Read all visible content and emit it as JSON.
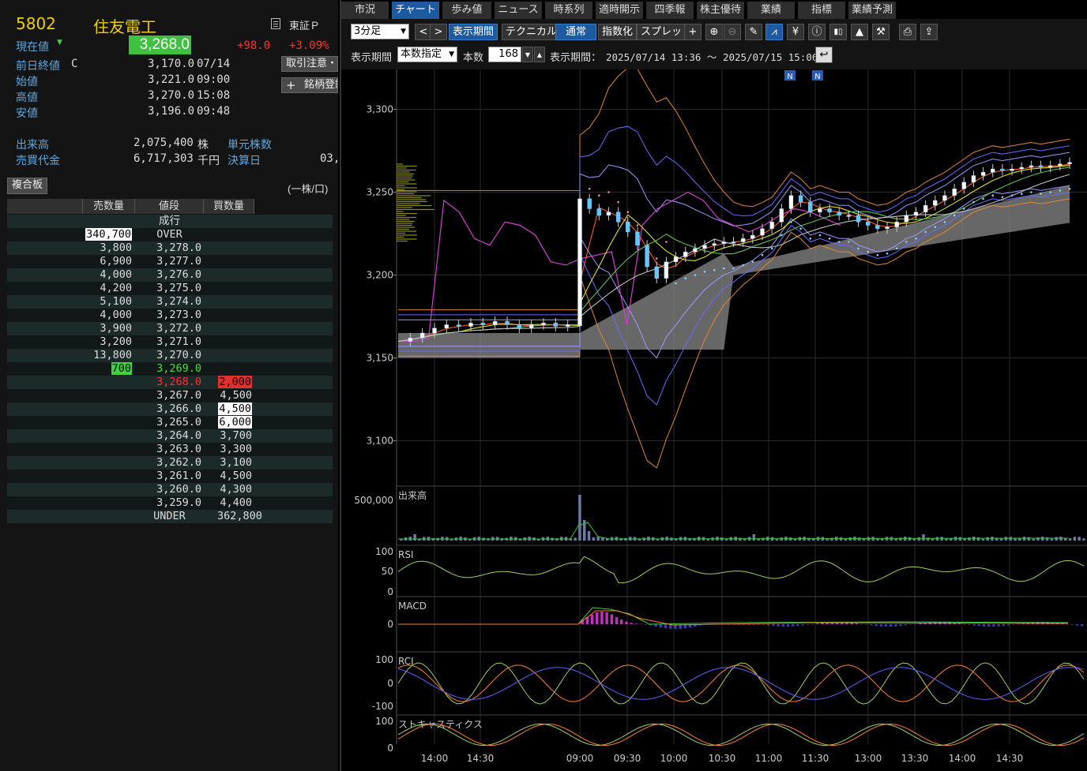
{
  "stock": {
    "code": "5802",
    "name": "住友電工",
    "market": "東証Ｐ",
    "current_label": "現在値",
    "current_price": "3,268.0",
    "change": "+98.0",
    "change_pct": "+3.09%",
    "prev_close_label": "前日終値",
    "prev_close_flag": "C",
    "prev_close": "3,170.0",
    "prev_close_date": "07/14",
    "open_label": "始値",
    "open": "3,221.0",
    "open_time": "09:00",
    "high_label": "高値",
    "high": "3,270.0",
    "high_time": "15:08",
    "low_label": "安値",
    "low": "3,196.0",
    "low_time": "09:48",
    "volume_label": "出来高",
    "volume": "2,075,400",
    "volume_unit": "株",
    "turnover_label": "売買代金",
    "turnover": "6,717,303",
    "turnover_unit": "千円",
    "unit_shares_label": "単元株数",
    "settlement_label": "決算日",
    "settlement_value": "03,"
  },
  "buttons": {
    "trade_caution": "取引注意・",
    "register": "銘柄登録",
    "composite_board": "複合板",
    "per_share": "(一株/口)"
  },
  "board": {
    "headers": [
      "売数量",
      "値段",
      "買数量"
    ],
    "market_order": "成行",
    "over_qty": "340,700",
    "over_label": "OVER",
    "under_label": "UNDER",
    "under_qty": "362,800",
    "asks": [
      {
        "qty": "3,800",
        "price": "3,278.0"
      },
      {
        "qty": "6,900",
        "price": "3,277.0"
      },
      {
        "qty": "4,000",
        "price": "3,276.0"
      },
      {
        "qty": "4,200",
        "price": "3,275.0"
      },
      {
        "qty": "5,100",
        "price": "3,274.0"
      },
      {
        "qty": "4,000",
        "price": "3,273.0"
      },
      {
        "qty": "3,900",
        "price": "3,272.0"
      },
      {
        "qty": "3,200",
        "price": "3,271.0"
      },
      {
        "qty": "13,800",
        "price": "3,270.0"
      },
      {
        "qty": "700",
        "price": "3,269.0"
      }
    ],
    "bids": [
      {
        "price": "3,268.0",
        "qty": "2,000"
      },
      {
        "price": "3,267.0",
        "qty": "4,500"
      },
      {
        "price": "3,266.0",
        "qty": "4,500"
      },
      {
        "price": "3,265.0",
        "qty": "6,000"
      },
      {
        "price": "3,264.0",
        "qty": "3,700"
      },
      {
        "price": "3,263.0",
        "qty": "3,300"
      },
      {
        "price": "3,262.0",
        "qty": "3,100"
      },
      {
        "price": "3,261.0",
        "qty": "4,500"
      },
      {
        "price": "3,260.0",
        "qty": "4,300"
      },
      {
        "price": "3,259.0",
        "qty": "4,400"
      }
    ]
  },
  "tabs": [
    "市況",
    "チャート",
    "歩み値",
    "ニュース",
    "時系列",
    "適時開示",
    "四季報",
    "株主優待",
    "業績",
    "指標",
    "業績予測"
  ],
  "active_tab": "チャート",
  "toolbar": {
    "interval": "3分足",
    "display_period_btn": "表示期間",
    "technical_btn": "テクニカル",
    "normal_btn": "通常",
    "index_btn": "指数化",
    "spread_btn": "スプレッド",
    "display_period_label": "表示期間",
    "period_mode": "本数指定",
    "bars_label": "本数",
    "bars_value": "168",
    "range_label": "表示期間：",
    "range_value": "2025/07/14 13:36 ～ 2025/07/15 15:06"
  },
  "chart_data": {
    "type": "line",
    "price_axis": {
      "ticks": [
        "3,300",
        "3,250",
        "3,200",
        "3,150",
        "3,100"
      ],
      "ylim": [
        3075,
        3325
      ]
    },
    "x_ticks": [
      "14:00",
      "14:30",
      "09:00",
      "09:30",
      "10:00",
      "10:30",
      "11:00",
      "11:30",
      "13:00",
      "13:30",
      "14:00",
      "14:30"
    ],
    "news_markers": [
      "N",
      "N"
    ],
    "close_series": [
      3160,
      3162,
      3165,
      3168,
      3170,
      3169,
      3171,
      3170,
      3172,
      3170,
      3168,
      3170,
      3171,
      3169,
      3170,
      3170,
      3246,
      3240,
      3236,
      3238,
      3232,
      3226,
      3218,
      3205,
      3198,
      3208,
      3211,
      3214,
      3216,
      3218,
      3219,
      3220,
      3220,
      3222,
      3224,
      3228,
      3232,
      3240,
      3248,
      3244,
      3238,
      3240,
      3238,
      3236,
      3236,
      3232,
      3230,
      3228,
      3229,
      3232,
      3236,
      3238,
      3242,
      3245,
      3248,
      3252,
      3256,
      3260,
      3262,
      3264,
      3263,
      3264,
      3265,
      3266,
      3265,
      3266,
      3267,
      3268
    ],
    "panels": [
      {
        "name": "出来高",
        "ticks": [
          "500,000"
        ]
      },
      {
        "name": "RSI",
        "ticks": [
          "100",
          "50",
          "0"
        ]
      },
      {
        "name": "MACD",
        "ticks": [
          "0"
        ]
      },
      {
        "name": "RCI",
        "ticks": [
          "100",
          "0",
          "-100"
        ]
      },
      {
        "name": "ストキャスティクス",
        "ticks": [
          "100",
          "0"
        ]
      }
    ]
  }
}
